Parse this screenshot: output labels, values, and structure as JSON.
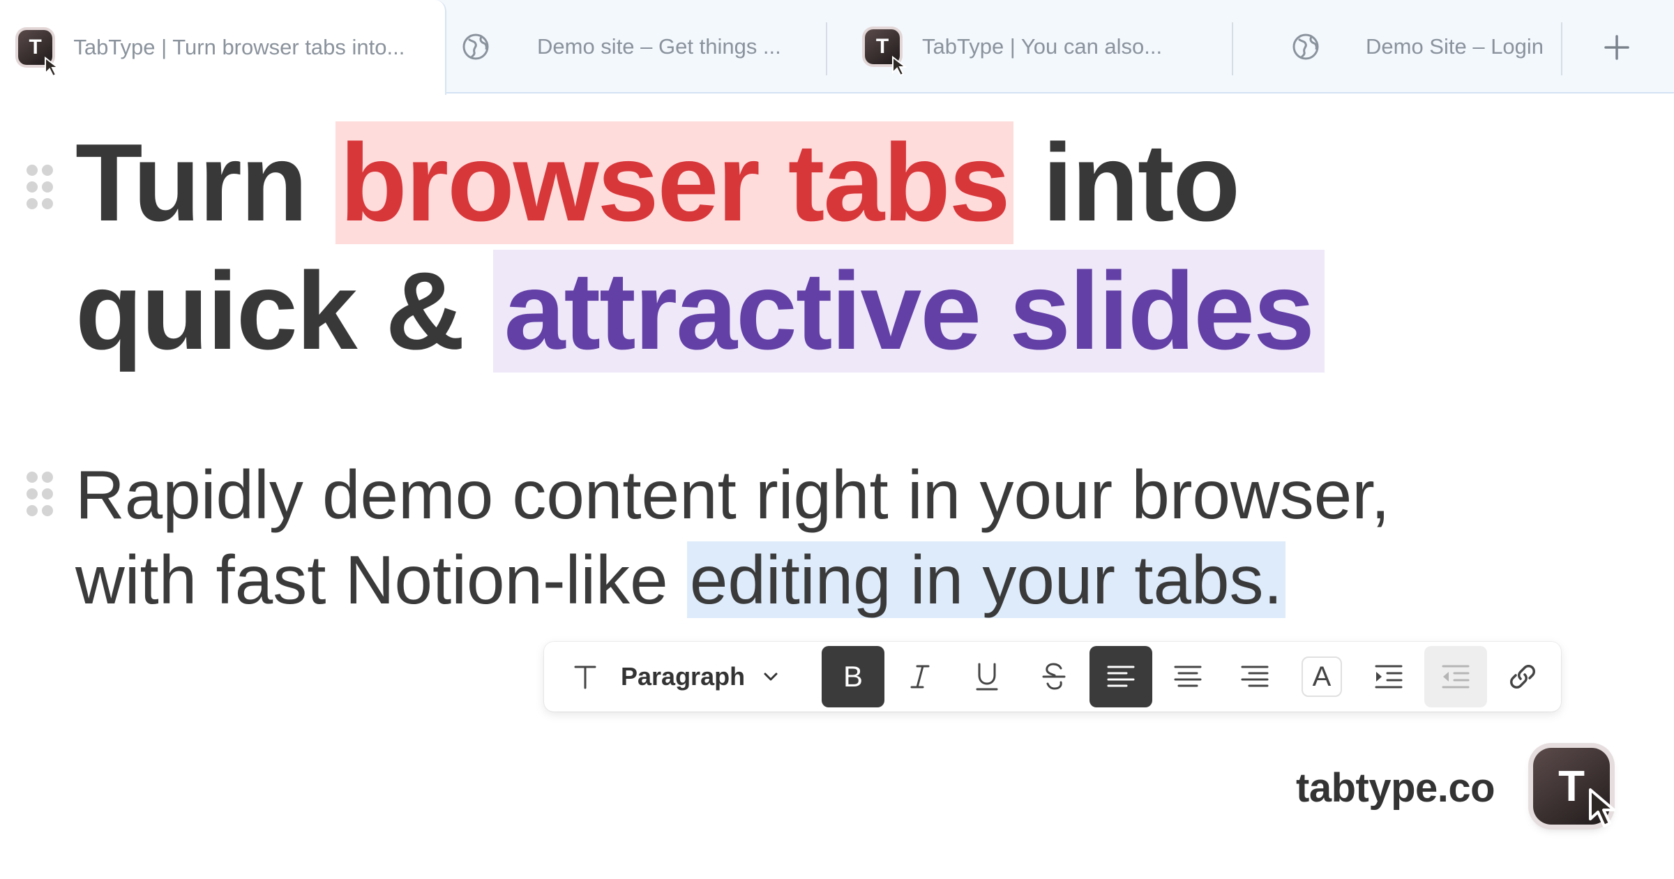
{
  "tabs": [
    {
      "label": "TabType | Turn browser tabs into...",
      "icon": "tabtype-favicon-icon",
      "active": true
    },
    {
      "label": "Demo site – Get things ...",
      "icon": "globe-icon",
      "active": false
    },
    {
      "label": "TabType | You can also...",
      "icon": "tabtype-favicon-icon",
      "active": false
    },
    {
      "label": "Demo Site – Login",
      "icon": "globe-icon",
      "active": false
    }
  ],
  "favicon_letter": "T",
  "heading": {
    "part1": "Turn ",
    "highlight1": "browser tabs",
    "part2": " into",
    "part3": "quick & ",
    "highlight2": "attractive slides"
  },
  "paragraph": {
    "line1": "Rapidly demo content right in your browser,",
    "line2_plain": "with fast Notion-like ",
    "line2_highlight": "editing in your tabs."
  },
  "toolbar": {
    "text_style_icon": "T",
    "block_type": "Paragraph",
    "buttons": [
      "bold-icon",
      "italic-icon",
      "underline-icon",
      "strikethrough-icon",
      "align-left-icon",
      "align-center-icon",
      "align-right-icon",
      "text-color-icon",
      "indent-icon",
      "outdent-icon",
      "link-icon"
    ],
    "bold_label": "B",
    "italic_label": "I",
    "underline_label": "U",
    "strike_label": "S",
    "color_label": "A"
  },
  "brand": {
    "url": "tabtype.co",
    "logo_letter": "T"
  },
  "colors": {
    "red_text": "#d8373a",
    "red_bg": "#ffdcdc",
    "purple_text": "#6340a6",
    "purple_bg": "#efe8f9",
    "blue_bg": "#deebfb",
    "tab_bar": "#f3f8fd"
  }
}
